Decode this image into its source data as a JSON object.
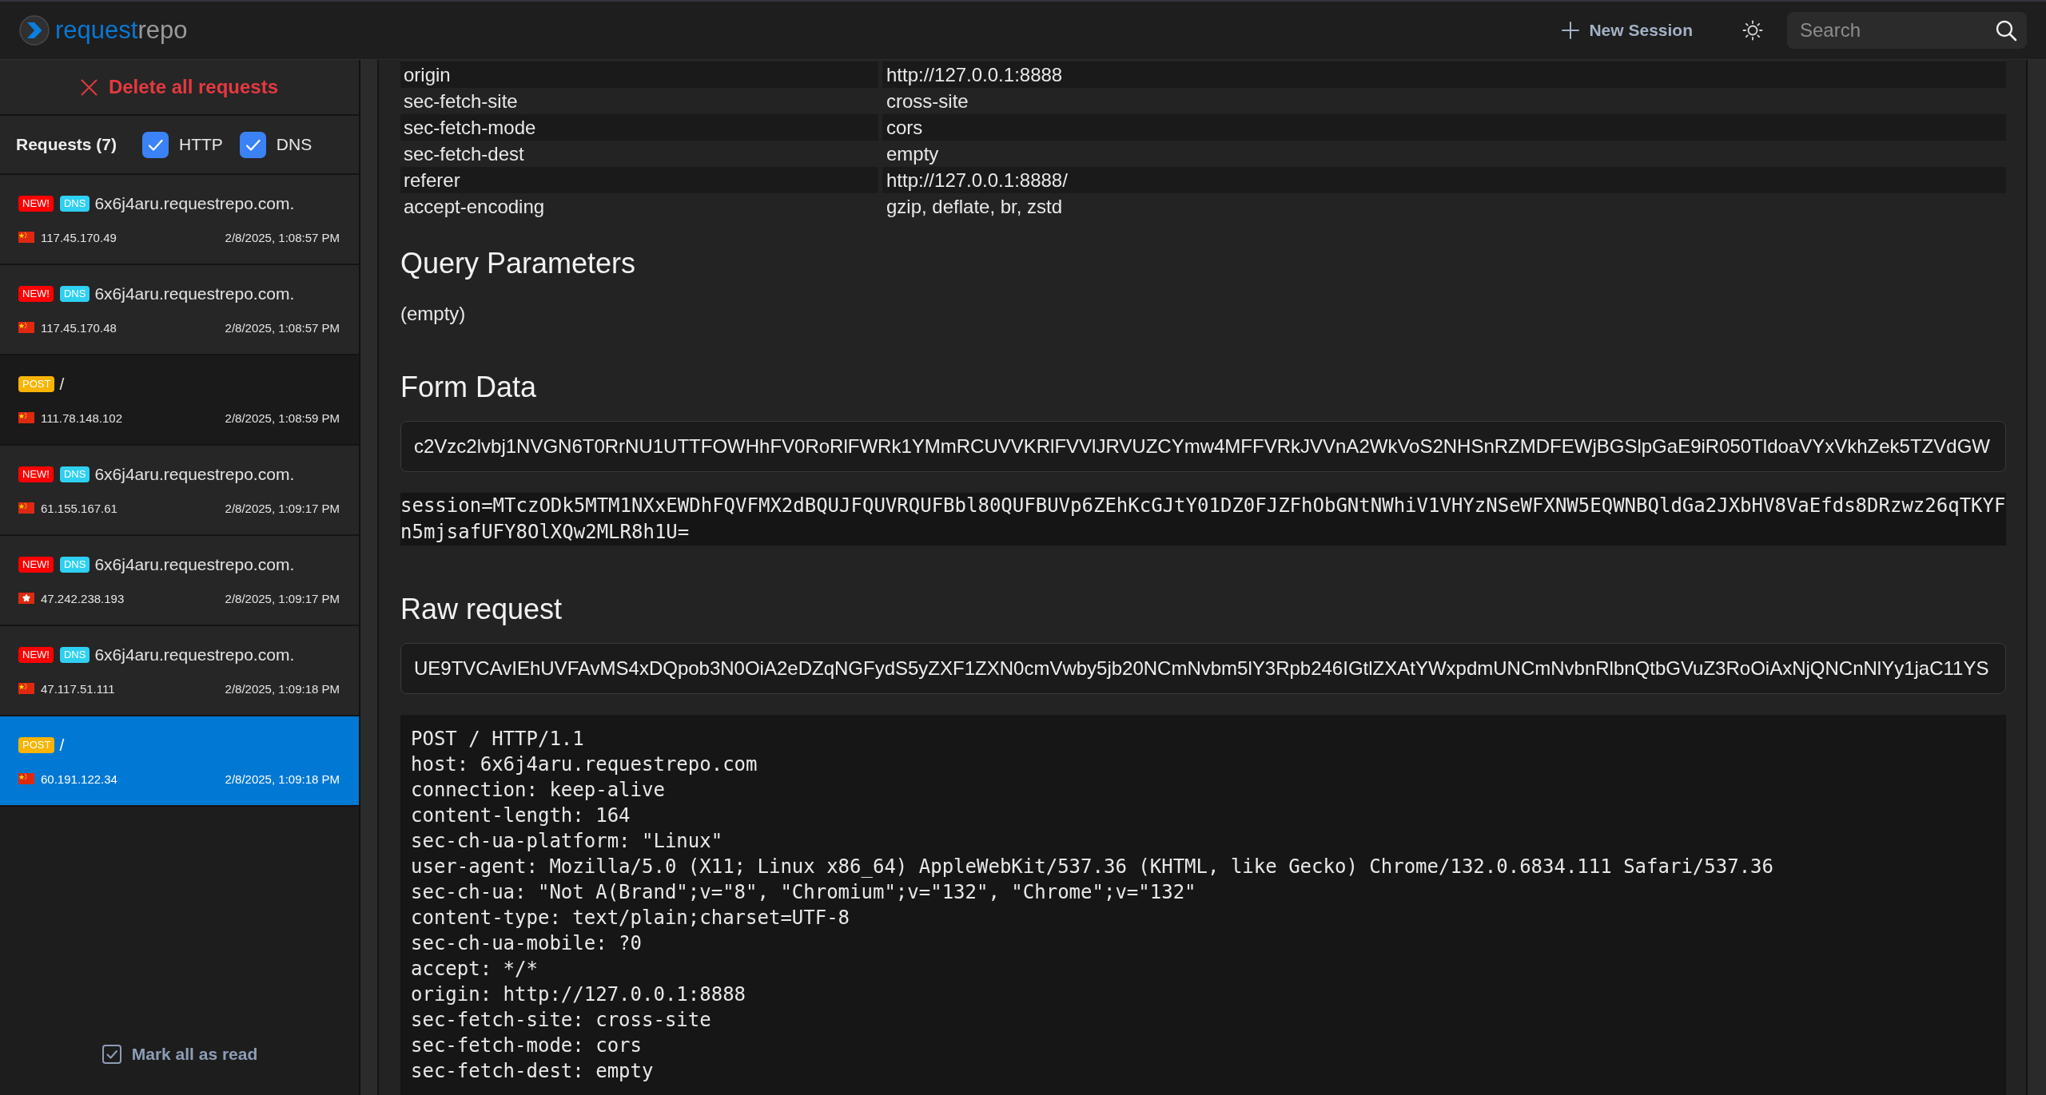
{
  "header": {
    "logo": {
      "primary": "request",
      "secondary": "repo"
    },
    "new_session": "New Session",
    "search": {
      "placeholder": "Search"
    }
  },
  "sidebar": {
    "delete_all": "Delete all requests",
    "requests_label": "Requests (7)",
    "filters": [
      {
        "label": "HTTP",
        "checked": true
      },
      {
        "label": "DNS",
        "checked": true
      }
    ],
    "requests": [
      {
        "unread": true,
        "new_badge": "NEW!",
        "type": "DNS",
        "kind": "dns",
        "title": "6x6j4aru.requestrepo.com.",
        "flag": {
          "kind": "cn"
        },
        "ip": "117.45.170.49",
        "time": "2/8/2025, 1:08:57 PM",
        "selected": false
      },
      {
        "unread": true,
        "new_badge": "NEW!",
        "type": "DNS",
        "kind": "dns",
        "title": "6x6j4aru.requestrepo.com.",
        "flag": {
          "kind": "cn"
        },
        "ip": "117.45.170.48",
        "time": "2/8/2025, 1:08:57 PM",
        "selected": false
      },
      {
        "unread": false,
        "type": "POST",
        "kind": "http",
        "title": "/",
        "flag": {
          "kind": "cn"
        },
        "ip": "111.78.148.102",
        "time": "2/8/2025, 1:08:59 PM",
        "selected": false
      },
      {
        "unread": true,
        "new_badge": "NEW!",
        "type": "DNS",
        "kind": "dns",
        "title": "6x6j4aru.requestrepo.com.",
        "flag": {
          "kind": "cn"
        },
        "ip": "61.155.167.61",
        "time": "2/8/2025, 1:09:17 PM",
        "selected": false
      },
      {
        "unread": true,
        "new_badge": "NEW!",
        "type": "DNS",
        "kind": "dns",
        "title": "6x6j4aru.requestrepo.com.",
        "flag": {
          "kind": "hk"
        },
        "ip": "47.242.238.193",
        "time": "2/8/2025, 1:09:17 PM",
        "selected": false
      },
      {
        "unread": true,
        "new_badge": "NEW!",
        "type": "DNS",
        "kind": "dns",
        "title": "6x6j4aru.requestrepo.com.",
        "flag": {
          "kind": "cn"
        },
        "ip": "47.117.51.111",
        "time": "2/8/2025, 1:09:18 PM",
        "selected": false
      },
      {
        "unread": false,
        "type": "POST",
        "kind": "http",
        "title": "/",
        "flag": {
          "kind": "cn"
        },
        "ip": "60.191.122.34",
        "time": "2/8/2025, 1:09:18 PM",
        "selected": true
      }
    ],
    "mark_all_read": "Mark all as read"
  },
  "main": {
    "headers": [
      {
        "name": "origin",
        "value": "http://127.0.0.1:8888"
      },
      {
        "name": "sec-fetch-site",
        "value": "cross-site"
      },
      {
        "name": "sec-fetch-mode",
        "value": "cors"
      },
      {
        "name": "sec-fetch-dest",
        "value": "empty"
      },
      {
        "name": "referer",
        "value": "http://127.0.0.1:8888/"
      },
      {
        "name": "accept-encoding",
        "value": "gzip, deflate, br, zstd"
      }
    ],
    "query_parameters": {
      "title": "Query Parameters",
      "empty_text": "(empty)"
    },
    "form_data": {
      "title": "Form Data",
      "encoded": "c2Vzc2lvbj1NVGN6T0RrNU1UTTFOWHhFV0RoRlFWRk1YMmRCUVVKRlFVVlJRVUZCYmw4MFFVRkJVVnA2WkVoS2NHSnRZMDFEWjBGSlpGaE9iR050TldoaVYxVkhZek5TZVdGW",
      "decoded": "session=MTczODk5MTM1NXxEWDhFQVFMX2dBQUJFQUVRQUFBbl80QUFBUVp6ZEhKcGJtY01DZ0FJZFhObGNtNWhiV1VHYzNSeWFXNW5EQWNBQldGa2JXbHV8VaEfds8DRzwz26qTKYFn5mjsafUFY8OlXQw2MLR8h1U="
    },
    "raw_request": {
      "title": "Raw request",
      "encoded": "UE9TVCAvIEhUVFAvMS4xDQpob3N0OiA2eDZqNGFydS5yZXF1ZXN0cmVwby5jb20NCmNvbm5lY3Rpb246IGtlZXAtYWxpdmUNCmNvbnRlbnQtbGVuZ3RoOiAxNjQNCnNlYy1jaC11YS",
      "lines": [
        "POST / HTTP/1.1",
        "host: 6x6j4aru.requestrepo.com",
        "connection: keep-alive",
        "content-length: 164",
        "sec-ch-ua-platform: \"Linux\"",
        "user-agent: Mozilla/5.0 (X11; Linux x86_64) AppleWebKit/537.36 (KHTML, like Gecko) Chrome/132.0.6834.111 Safari/537.36",
        "sec-ch-ua: \"Not A(Brand\";v=\"8\", \"Chromium\";v=\"132\", \"Chrome\";v=\"132\"",
        "content-type: text/plain;charset=UTF-8",
        "sec-ch-ua-mobile: ?0",
        "accept: */*",
        "origin: http://127.0.0.1:8888",
        "sec-fetch-site: cross-site",
        "sec-fetch-mode: cors",
        "sec-fetch-dest: empty"
      ]
    }
  }
}
